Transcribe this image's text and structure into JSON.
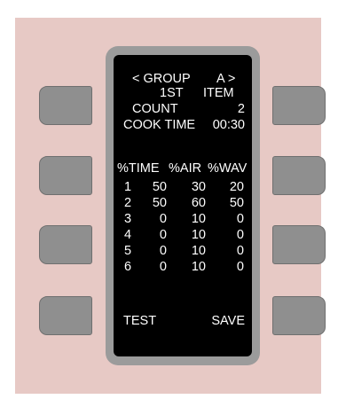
{
  "colors": {
    "panel": "#e7c9c5",
    "bezel": "#9b9b9b",
    "screen": "#000000",
    "button": "#8f8f8f",
    "text": "#ffffff"
  },
  "header": {
    "group_label": "< GROUP",
    "group_value": "A >",
    "item_number": "1ST",
    "item_label": "ITEM",
    "count_label": "COUNT",
    "count_value": "2",
    "cook_time_label": "COOK TIME",
    "cook_time_value": "00:30"
  },
  "table": {
    "headers": [
      "%TIME",
      "%AIR",
      "%WAV"
    ],
    "rows": [
      {
        "n": "1",
        "time": "50",
        "air": "30",
        "wav": "20"
      },
      {
        "n": "2",
        "time": "50",
        "air": "60",
        "wav": "50"
      },
      {
        "n": "3",
        "time": "0",
        "air": "10",
        "wav": "0"
      },
      {
        "n": "4",
        "time": "0",
        "air": "10",
        "wav": "0"
      },
      {
        "n": "5",
        "time": "0",
        "air": "10",
        "wav": "0"
      },
      {
        "n": "6",
        "time": "0",
        "air": "10",
        "wav": "0"
      }
    ]
  },
  "footer": {
    "test_label": "TEST",
    "save_label": "SAVE"
  }
}
